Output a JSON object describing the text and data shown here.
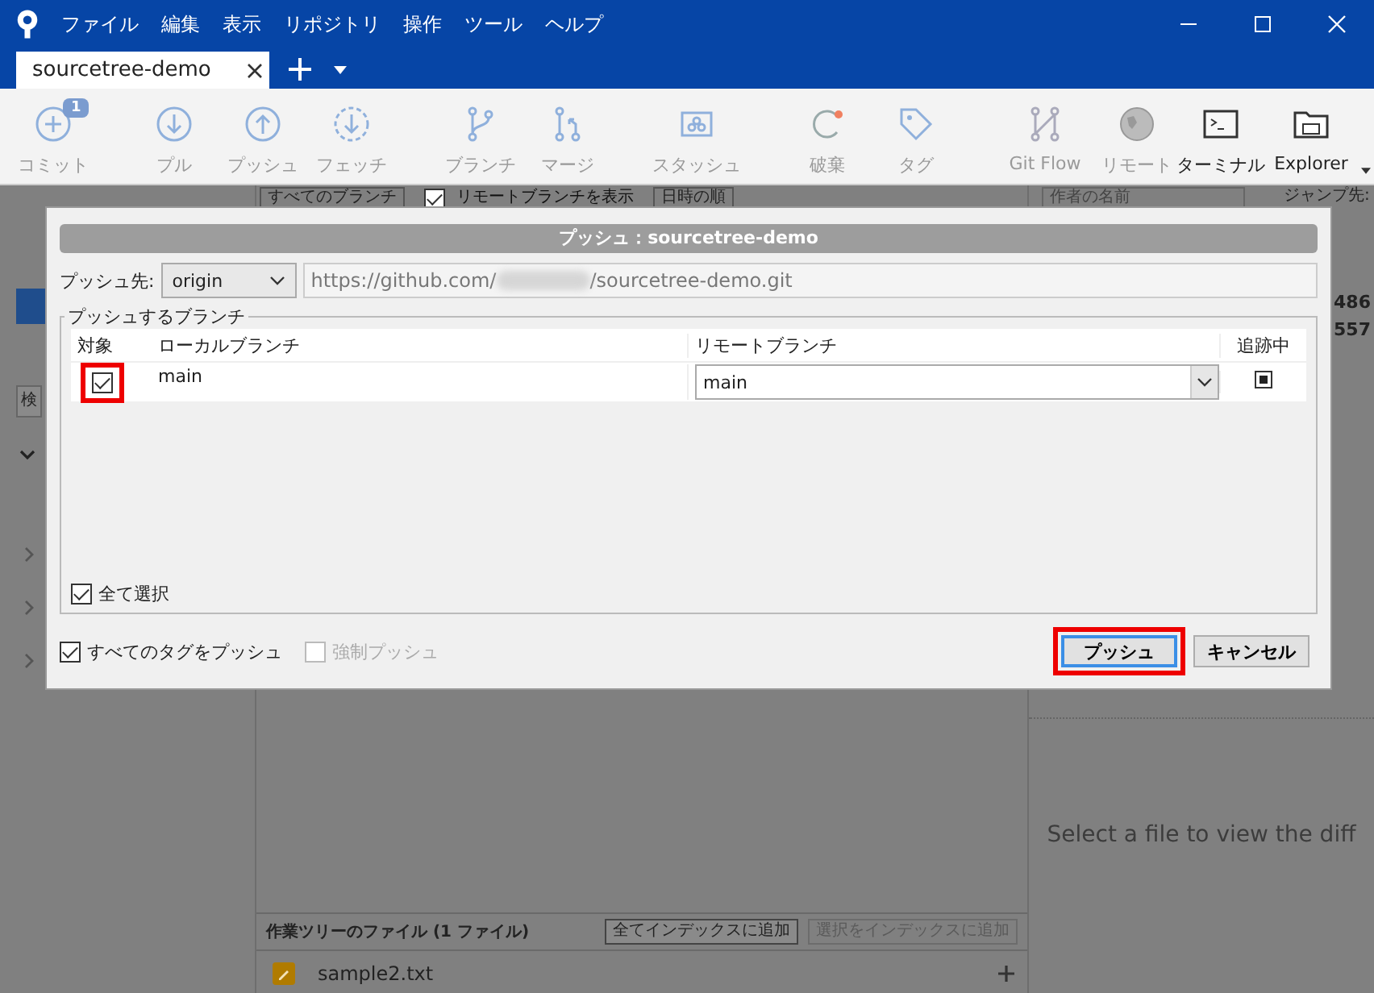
{
  "window": {
    "menu": [
      "ファイル",
      "編集",
      "表示",
      "リポジトリ",
      "操作",
      "ツール",
      "ヘルプ"
    ]
  },
  "tabs": [
    {
      "label": "sourcetree-demo",
      "selected": true
    }
  ],
  "toolbar": [
    {
      "label": "コミット",
      "badge": "1",
      "disabled": true
    },
    {
      "label": "プル",
      "disabled": true
    },
    {
      "label": "プッシュ",
      "disabled": true
    },
    {
      "label": "フェッチ",
      "disabled": true
    },
    {
      "label": "ブランチ",
      "disabled": true
    },
    {
      "label": "マージ",
      "disabled": true
    },
    {
      "label": "スタッシュ",
      "disabled": true
    },
    {
      "label": "破棄",
      "disabled": true
    },
    {
      "label": "タグ",
      "disabled": true
    },
    {
      "label": "Git Flow",
      "disabled": true
    },
    {
      "label": "リモート",
      "disabled": true
    },
    {
      "label": "ターミナル",
      "disabled": false
    },
    {
      "label": "Explorer",
      "disabled": false
    }
  ],
  "log_filters": {
    "branch_filter": "すべてのブランチ",
    "show_remote": {
      "label": "リモートブランチを表示",
      "checked": true
    },
    "sort": "日時の順",
    "author_search": {
      "placeholder": "作者の名前"
    },
    "jump_label": "ジャンプ先:"
  },
  "commit_list": {
    "rows": [
      "486",
      "557"
    ]
  },
  "sidebar": {
    "search_button": "検"
  },
  "working_tree": {
    "title": "作業ツリーのファイル (1 ファイル)",
    "buttons": [
      {
        "label": "全てインデックスに追加",
        "disabled": false
      },
      {
        "label": "選択をインデックスに追加",
        "disabled": true
      }
    ],
    "files": [
      {
        "name": "sample2.txt"
      }
    ]
  },
  "diff_placeholder": "Select a file to view the diff",
  "dialog": {
    "title": "プッシュ：sourcetree-demo",
    "remote": {
      "label": "プッシュ先:",
      "value": "origin"
    },
    "url": {
      "prefix": "https://github.com/",
      "suffix": "/sourcetree-demo.git"
    },
    "branches": {
      "title": "プッシュするブランチ",
      "columns": [
        "対象",
        "ローカルブランチ",
        "リモートブランチ",
        "追跡中"
      ],
      "rows": [
        {
          "checked": true,
          "highlighted": true,
          "local": "main",
          "remote": "main",
          "tracking": true
        }
      ],
      "select_all": {
        "label": "全て選択",
        "checked": true
      }
    },
    "options": [
      {
        "label": "すべてのタグをプッシュ",
        "checked": true,
        "disabled": false
      },
      {
        "label": "強制プッシュ",
        "checked": false,
        "disabled": true
      }
    ],
    "buttons": [
      {
        "label": "プッシュ",
        "focused": true,
        "highlighted": true
      },
      {
        "label": "キャンセル",
        "focused": false,
        "highlighted": false
      }
    ]
  }
}
